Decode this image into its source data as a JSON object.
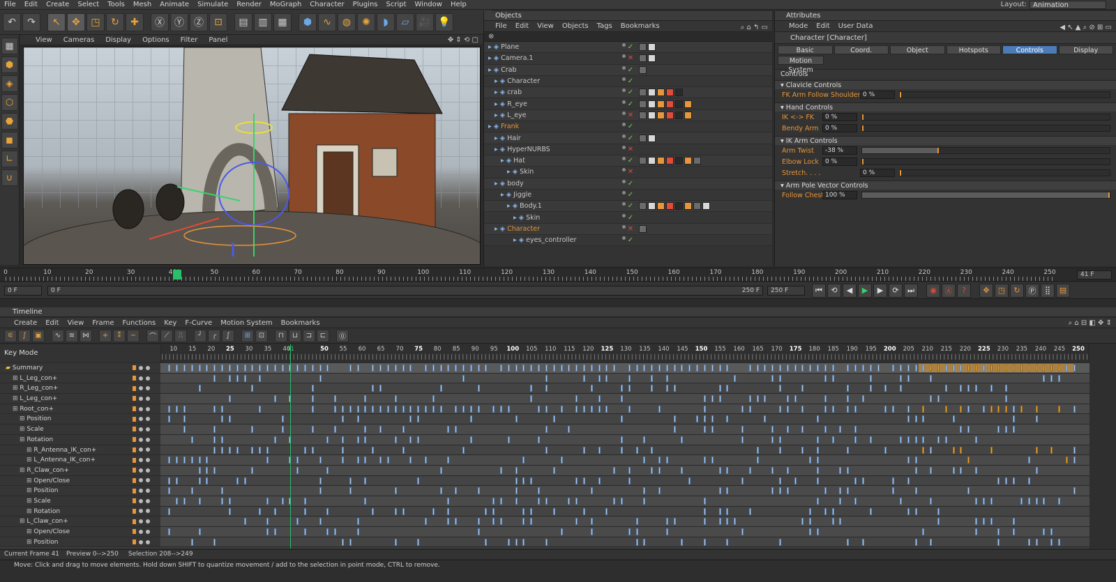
{
  "menubar": {
    "items": [
      "File",
      "Edit",
      "Create",
      "Select",
      "Tools",
      "Mesh",
      "Animate",
      "Simulate",
      "Render",
      "MoGraph",
      "Character",
      "Plugins",
      "Script",
      "Window",
      "Help"
    ],
    "layout_label": "Layout:",
    "layout_value": "Animation"
  },
  "viewport": {
    "menu": [
      "View",
      "Cameras",
      "Display",
      "Options",
      "Filter",
      "Panel"
    ]
  },
  "objects": {
    "title": "Objects",
    "menu": [
      "File",
      "Edit",
      "View",
      "Objects",
      "Tags",
      "Bookmarks"
    ],
    "rows": [
      {
        "name": "Plane",
        "indent": 0,
        "orange": false
      },
      {
        "name": "Camera.1",
        "indent": 0,
        "orange": false
      },
      {
        "name": "Crab",
        "indent": 0,
        "orange": false
      },
      {
        "name": "Character",
        "indent": 1,
        "orange": false
      },
      {
        "name": "crab",
        "indent": 1,
        "orange": false
      },
      {
        "name": "R_eye",
        "indent": 1,
        "orange": false
      },
      {
        "name": "L_eye",
        "indent": 1,
        "orange": false
      },
      {
        "name": "Frank",
        "indent": 0,
        "orange": true
      },
      {
        "name": "Hair",
        "indent": 1,
        "orange": false
      },
      {
        "name": "HyperNURBS",
        "indent": 1,
        "orange": false
      },
      {
        "name": "Hat",
        "indent": 2,
        "orange": false
      },
      {
        "name": "Skin",
        "indent": 3,
        "orange": false
      },
      {
        "name": "body",
        "indent": 1,
        "orange": false
      },
      {
        "name": "Jiggle",
        "indent": 2,
        "orange": false
      },
      {
        "name": "Body.1",
        "indent": 3,
        "orange": false
      },
      {
        "name": "Skin",
        "indent": 4,
        "orange": false
      },
      {
        "name": "Character",
        "indent": 1,
        "orange": true
      },
      {
        "name": "eyes_controller",
        "indent": 4,
        "orange": false
      }
    ]
  },
  "attributes": {
    "title": "Attributes",
    "menu": [
      "Mode",
      "Edit",
      "User Data"
    ],
    "object_name": "Character [Character]",
    "tabs": [
      "Basic",
      "Coord.",
      "Object",
      "Hotspots",
      "Controls",
      "Display"
    ],
    "active_tab": "Controls",
    "tab2": "Motion System",
    "section": "Controls",
    "groups": [
      {
        "title": "Clavicle Controls",
        "rows": [
          {
            "label": "FK Arm Follow Shoulder",
            "value": "0 %",
            "level": 0.0
          }
        ]
      },
      {
        "title": "Hand Controls",
        "rows": [
          {
            "label": "IK <-> FK",
            "value": "0 %",
            "level": 0.0
          },
          {
            "label": "Bendy Arm",
            "value": "0 %",
            "level": 0.0
          }
        ]
      },
      {
        "title": "IK Arm Controls",
        "rows": [
          {
            "label": "Arm Twist",
            "value": "-38 %",
            "level": 0.31
          },
          {
            "label": "Elbow Lock",
            "value": "0 %",
            "level": 0.0
          },
          {
            "label": "Stretch. . . .",
            "value": "0 %",
            "level": 0.0
          }
        ]
      },
      {
        "title": "Arm Pole Vector Controls",
        "rows": [
          {
            "label": "Follow Chest",
            "value": "100 %",
            "level": 1.0
          }
        ]
      }
    ]
  },
  "ruler": {
    "labels": [
      "0",
      "10",
      "20",
      "30",
      "40",
      "41",
      "50",
      "60",
      "70",
      "80",
      "90",
      "100",
      "110",
      "120",
      "130",
      "140",
      "150",
      "160",
      "170",
      "180",
      "190",
      "200",
      "210",
      "220",
      "230",
      "240",
      "250"
    ],
    "current_frame": "41 F"
  },
  "transport": {
    "start": "0 F",
    "range_start": "0 F",
    "range_end": "250 F",
    "end": "250 F"
  },
  "timeline": {
    "title": "Timeline",
    "menu": [
      "Create",
      "Edit",
      "View",
      "Frame",
      "Functions",
      "Key",
      "F-Curve",
      "Motion System",
      "Bookmarks"
    ],
    "key_mode": "Key Mode",
    "ruler_labels": [
      "10",
      "15",
      "20",
      "25",
      "30",
      "35",
      "40",
      "41",
      "50",
      "55",
      "60",
      "65",
      "70",
      "75",
      "80",
      "85",
      "90",
      "95",
      "100",
      "105",
      "110",
      "115",
      "120",
      "125",
      "130",
      "135",
      "140",
      "145",
      "150",
      "155",
      "160",
      "165",
      "170",
      "175",
      "180",
      "185",
      "190",
      "195",
      "200",
      "205",
      "210",
      "215",
      "220",
      "225",
      "230",
      "235",
      "240",
      "245",
      "250"
    ],
    "tracks": [
      {
        "name": "Summary",
        "indent": 0
      },
      {
        "name": "L_Leg_con+",
        "indent": 1
      },
      {
        "name": "R_Leg_con+",
        "indent": 1
      },
      {
        "name": "L_Leg_con+",
        "indent": 1
      },
      {
        "name": "Root_con+",
        "indent": 1
      },
      {
        "name": "Position",
        "indent": 2
      },
      {
        "name": "Scale",
        "indent": 2
      },
      {
        "name": "Rotation",
        "indent": 2
      },
      {
        "name": "R_Antenna_IK_con+",
        "indent": 3
      },
      {
        "name": "L_Antenna_IK_con+",
        "indent": 3
      },
      {
        "name": "R_Claw_con+",
        "indent": 2
      },
      {
        "name": "Open/Close",
        "indent": 3
      },
      {
        "name": "Position",
        "indent": 3
      },
      {
        "name": "Scale",
        "indent": 3
      },
      {
        "name": "Rotation",
        "indent": 3
      },
      {
        "name": "L_Claw_con+",
        "indent": 2
      },
      {
        "name": "Open/Close",
        "indent": 3
      },
      {
        "name": "Position",
        "indent": 3
      }
    ],
    "status_current": "Current Frame  41",
    "status_preview": "Preview  0-->250",
    "status_selection": "Selection 208-->249"
  },
  "statusbar": {
    "hint": "Move: Click and drag to move elements. Hold down SHIFT to quantize movement / add to the selection in point mode, CTRL to remove."
  },
  "colors": {
    "accent": "#e8963a",
    "active_tab": "#4b7cb8",
    "key": "#a9c7ea",
    "playhead": "#2bbf6a"
  }
}
